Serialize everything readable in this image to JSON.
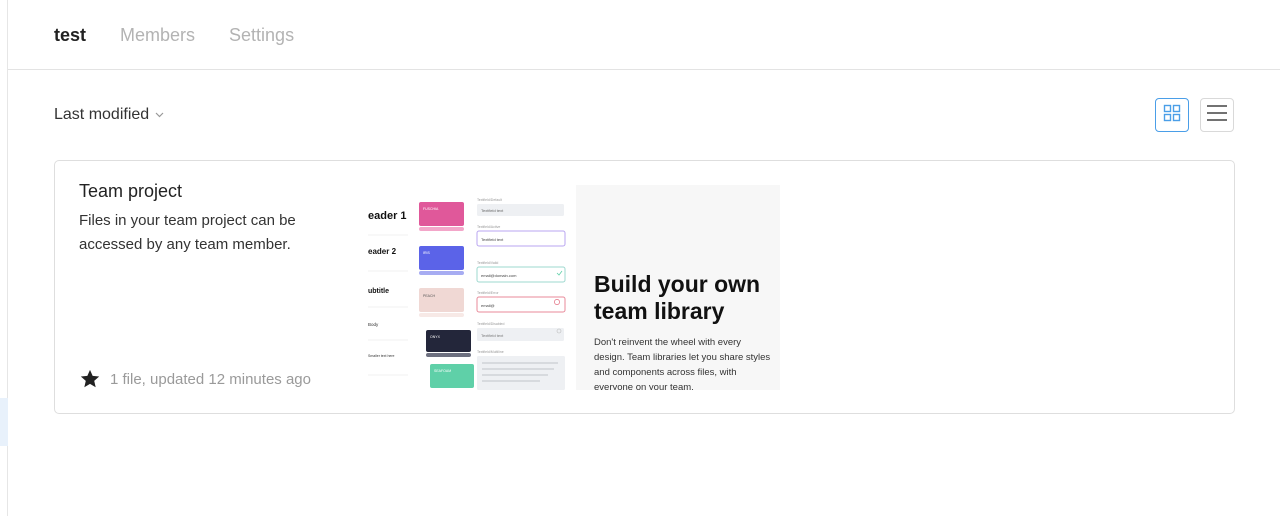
{
  "tabs": [
    {
      "label": "test"
    },
    {
      "label": "Members"
    },
    {
      "label": "Settings"
    }
  ],
  "sort": {
    "label": "Last modified"
  },
  "project": {
    "title": "Team project",
    "description": "Files in your team project can be accessed by any team member.",
    "meta": "1 file, updated 12 minutes ago",
    "thumb_left": {
      "headers": [
        "eader 1",
        "eader 2",
        "ubtitle",
        "Body",
        "Smaller text here"
      ],
      "swatches": [
        "FUSCHIA",
        "IRIS",
        "PEACH",
        "ONYX",
        "SEAFOAM"
      ],
      "fields": [
        "Textfield text",
        "Textfield text",
        "email@domain.com",
        "email@",
        "Textfield text"
      ],
      "field_labels": [
        "Textfield/Default",
        "Textfield/Active",
        "Textfield/Valid",
        "Textfield/Error",
        "Textfield/Disabled",
        "Textfield/Multiline"
      ]
    },
    "thumb_right": {
      "title": "Build your own team library",
      "text": "Don't reinvent the wheel with every design. Team libraries let you share styles and components across files, with everyone on your team."
    }
  },
  "colors": {
    "accent": "#4a9ee8",
    "fuschia": "#e0589a",
    "iris": "#5b63e8",
    "peach": "#f0d8d4",
    "onyx": "#23263a",
    "seafoam": "#5fd0a8"
  }
}
